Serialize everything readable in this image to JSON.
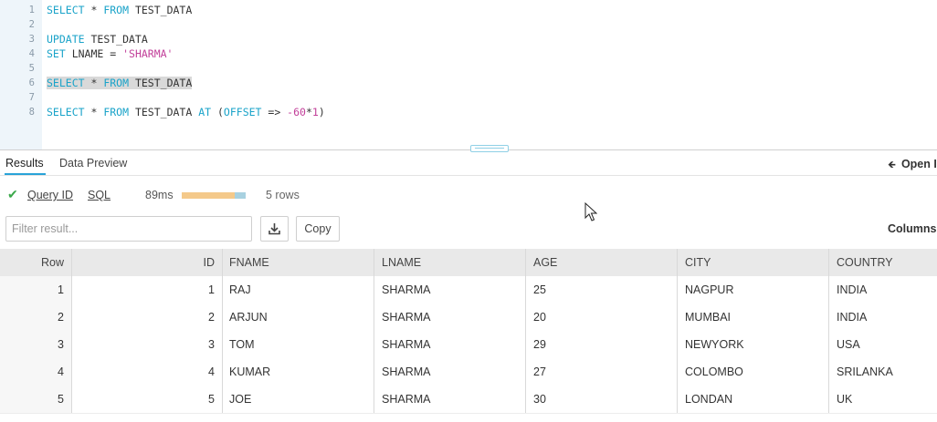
{
  "editor": {
    "lines": [
      {
        "n": "1",
        "tokens": [
          {
            "t": "SELECT",
            "c": "kw"
          },
          {
            "t": " * ",
            "c": ""
          },
          {
            "t": "FROM",
            "c": "kw"
          },
          {
            "t": " TEST_DATA",
            "c": ""
          }
        ]
      },
      {
        "n": "2",
        "tokens": []
      },
      {
        "n": "3",
        "tokens": [
          {
            "t": "UPDATE",
            "c": "kw"
          },
          {
            "t": " TEST_DATA",
            "c": ""
          }
        ]
      },
      {
        "n": "4",
        "tokens": [
          {
            "t": "SET",
            "c": "kw"
          },
          {
            "t": " LNAME = ",
            "c": ""
          },
          {
            "t": "'SHARMA'",
            "c": "str"
          }
        ]
      },
      {
        "n": "5",
        "tokens": []
      },
      {
        "n": "6",
        "selected": true,
        "tokens": [
          {
            "t": "SELECT",
            "c": "kw"
          },
          {
            "t": " * ",
            "c": ""
          },
          {
            "t": "FROM",
            "c": "kw"
          },
          {
            "t": " TEST_DATA",
            "c": ""
          }
        ]
      },
      {
        "n": "7",
        "tokens": []
      },
      {
        "n": "8",
        "tokens": [
          {
            "t": "SELECT",
            "c": "kw"
          },
          {
            "t": " * ",
            "c": ""
          },
          {
            "t": "FROM",
            "c": "kw"
          },
          {
            "t": " TEST_DATA ",
            "c": ""
          },
          {
            "t": "AT",
            "c": "kw"
          },
          {
            "t": " (",
            "c": ""
          },
          {
            "t": "OFFSET",
            "c": "kw"
          },
          {
            "t": " => ",
            "c": ""
          },
          {
            "t": "-60",
            "c": "num"
          },
          {
            "t": "*",
            "c": ""
          },
          {
            "t": "1",
            "c": "num"
          },
          {
            "t": ")",
            "c": ""
          }
        ]
      }
    ]
  },
  "tabs": {
    "results": "Results",
    "data_preview": "Data Preview",
    "open": "Open I"
  },
  "status": {
    "query_id": "Query ID",
    "sql": "SQL",
    "duration": "89ms",
    "duration_bar_fill": 0.83,
    "rows": "5 rows"
  },
  "toolbar": {
    "filter_placeholder": "Filter result...",
    "copy": "Copy",
    "columns": "Columns"
  },
  "table": {
    "headers": [
      "Row",
      "ID",
      "FNAME",
      "LNAME",
      "AGE",
      "CITY",
      "COUNTRY"
    ],
    "rows": [
      [
        "1",
        "1",
        "RAJ",
        "SHARMA",
        "25",
        "NAGPUR",
        "INDIA"
      ],
      [
        "2",
        "2",
        "ARJUN",
        "SHARMA",
        "20",
        "MUMBAI",
        "INDIA"
      ],
      [
        "3",
        "3",
        "TOM",
        "SHARMA",
        "29",
        "NEWYORK",
        "USA"
      ],
      [
        "4",
        "4",
        "KUMAR",
        "SHARMA",
        "27",
        "COLOMBO",
        "SRILANKA"
      ],
      [
        "5",
        "5",
        "JOE",
        "SHARMA",
        "30",
        "LONDAN",
        "UK"
      ]
    ]
  },
  "colors": {
    "keyword": "#1aa3c9",
    "string": "#c2409a",
    "success": "#3aa84a",
    "accent": "#29a3d8"
  }
}
